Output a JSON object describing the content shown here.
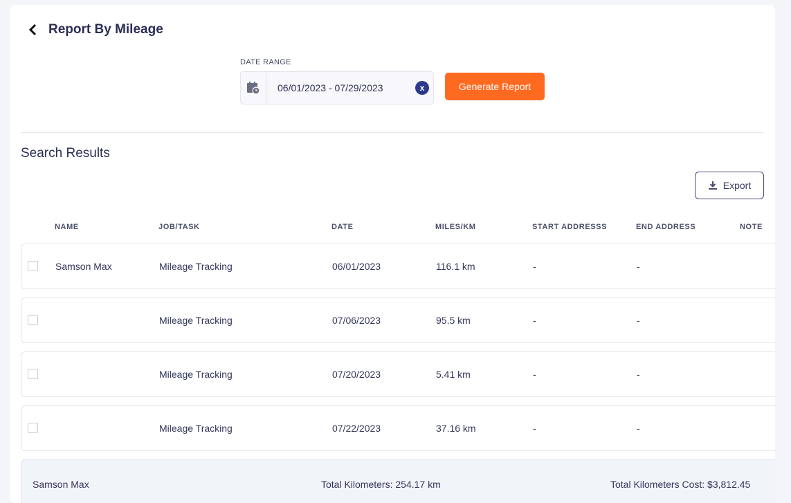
{
  "header": {
    "title": "Report By Mileage"
  },
  "filter": {
    "label": "DATE RANGE",
    "value": "06/01/2023 - 07/29/2023",
    "clear": "x",
    "generate": "Generate Report"
  },
  "results": {
    "title": "Search Results",
    "export": "Export"
  },
  "table": {
    "columns": [
      "NAME",
      "JOB/TASK",
      "DATE",
      "MILES/KM",
      "START ADDRESSS",
      "END ADDRESS",
      "NOTE"
    ],
    "rows": [
      {
        "name": "Samson Max",
        "job": "Mileage Tracking",
        "date": "06/01/2023",
        "miles": "116.1 km",
        "start": "-",
        "end": "-"
      },
      {
        "name": "",
        "job": "Mileage Tracking",
        "date": "07/06/2023",
        "miles": "95.5 km",
        "start": "-",
        "end": "-"
      },
      {
        "name": "",
        "job": "Mileage Tracking",
        "date": "07/20/2023",
        "miles": "5.41 km",
        "start": "-",
        "end": "-"
      },
      {
        "name": "",
        "job": "Mileage Tracking",
        "date": "07/22/2023",
        "miles": "37.16 km",
        "start": "-",
        "end": "-"
      }
    ]
  },
  "summary": {
    "name": "Samson Max",
    "total_km": "Total Kilometers: 254.17 km",
    "total_cost": "Total Kilometers Cost: $3,812.45"
  },
  "colors": {
    "accent": "#ff6a21",
    "primary": "#2d3a8c"
  }
}
